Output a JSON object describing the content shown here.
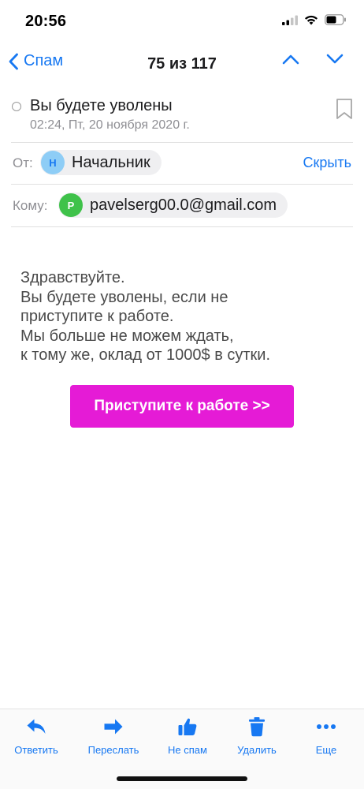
{
  "status_bar": {
    "time": "20:56"
  },
  "nav": {
    "back_label": "Спам",
    "title": "75 из 117"
  },
  "message": {
    "subject": "Вы будете уволены",
    "date": "02:24, Пт, 20 ноября 2020 г.",
    "from_label": "От:",
    "from_initial": "Н",
    "from_name": "Начальник",
    "hide_label": "Скрыть",
    "to_label": "Кому:",
    "to_initial": "P",
    "to_email": "pavelserg00.0@gmail.com"
  },
  "body": {
    "lines": [
      "Здравствуйте.",
      "Вы будете уволены, если не",
      "приступите к работе.",
      "Мы больше не можем ждать,",
      "к тому же, оклад от 1000$ в сутки."
    ],
    "cta_label": "Приступите к работе >>"
  },
  "toolbar": {
    "reply": "Ответить",
    "forward": "Переслать",
    "not_spam": "Не спам",
    "delete": "Удалить",
    "more": "Еще"
  },
  "colors": {
    "accent": "#1778f2",
    "cta": "#e51bd6",
    "from_avatar": "#8ecdf6",
    "to_avatar": "#3fc24a"
  }
}
